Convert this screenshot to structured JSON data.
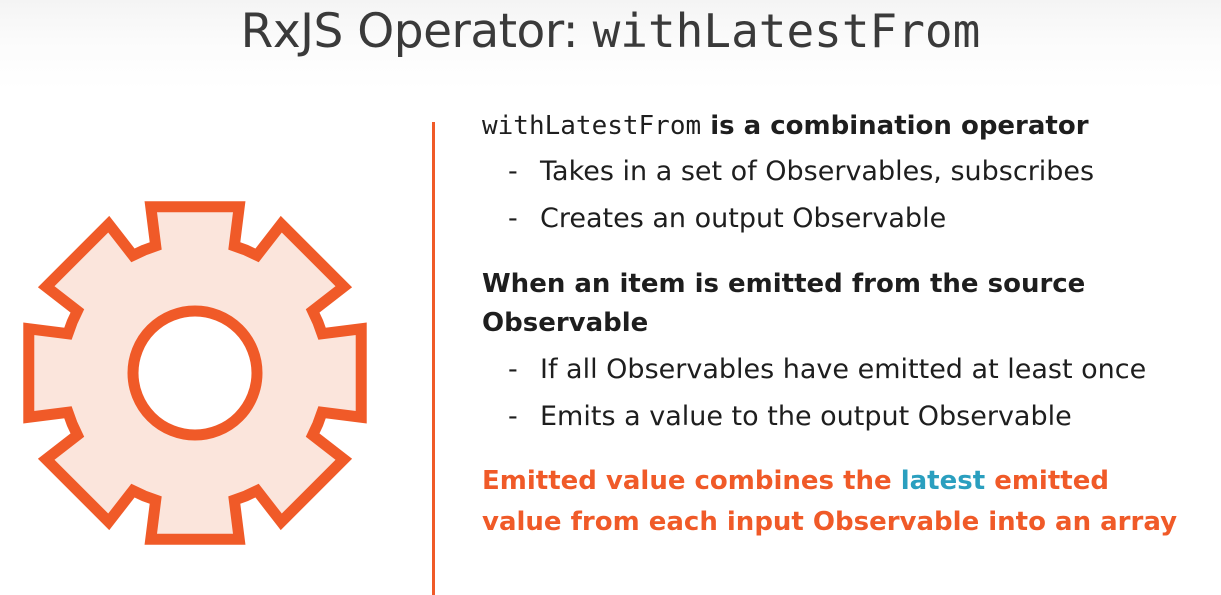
{
  "title": {
    "prefix": "RxJS Operator: ",
    "code": "withLatestFrom"
  },
  "icon": {
    "name": "gear-icon",
    "stroke_color": "#f05a28",
    "fill_color": "#fbe5dc"
  },
  "colors": {
    "accent": "#f05a28",
    "highlight": "#2a9fbf",
    "text": "#1e1e1e"
  },
  "section1": {
    "heading_code": "withLatestFrom",
    "heading_text": " is a combination operator",
    "bullets": [
      "Takes in a set of Observables, subscribes",
      "Creates an output Observable"
    ]
  },
  "section2": {
    "heading_line1": "When an item is emitted from the source",
    "heading_line2": "Observable",
    "bullets": [
      "If all Observables have emitted at least once",
      "Emits a value to the output Observable"
    ]
  },
  "section3": {
    "line1_part1": "Emitted value combines the ",
    "line1_highlight": "latest",
    "line1_part2": " emitted",
    "line2": "value from each input Observable into an array"
  },
  "bullet_marker": "-"
}
